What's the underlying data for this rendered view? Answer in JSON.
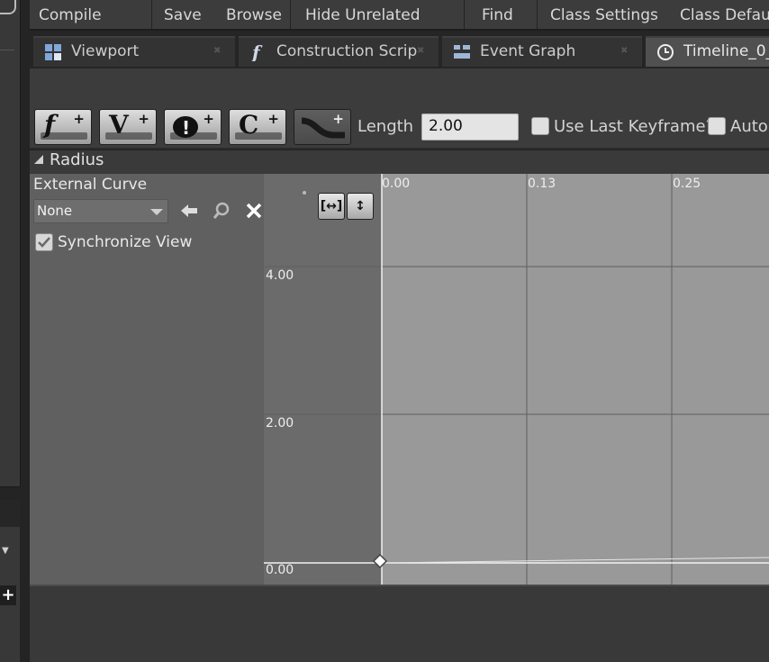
{
  "toolbar": {
    "compile": "Compile",
    "save": "Save",
    "browse": "Browse",
    "hide_unrelated": "Hide Unrelated",
    "find": "Find",
    "class_settings": "Class Settings",
    "class_defaults": "Class Defau"
  },
  "tabs": [
    {
      "label": "Viewport",
      "icon": "grid-icon"
    },
    {
      "label": "Construction Scrip",
      "icon": "function-icon"
    },
    {
      "label": "Event Graph",
      "icon": "event-graph-icon"
    },
    {
      "label": "Timeline_0_",
      "icon": "clock-icon"
    }
  ],
  "timeline_toolbar": {
    "add_float_glyph": "f",
    "add_vector_glyph": "V",
    "add_event_glyph": "!",
    "add_color_glyph": "C",
    "length_label": "Length",
    "length_value": "2.00",
    "use_last_keyframe": "Use Last Keyframe?",
    "use_last_keyframe_checked": false,
    "auto_label": "AutoP",
    "auto_checked": false
  },
  "track": {
    "name": "Radius",
    "external_curve_label": "External Curve",
    "external_curve_value": "None",
    "synchronize_view": "Synchronize View",
    "synchronize_checked": true
  },
  "graph": {
    "time_labels": [
      "0.00",
      "0.13",
      "0.25"
    ],
    "value_labels": [
      "4.00",
      "2.00",
      "0.00"
    ],
    "keyframes": [
      {
        "time": 0.0,
        "value": 0.0
      }
    ],
    "colors": {
      "background": "#999999",
      "outside": "#6b6b6b",
      "grid": "#5f5f5f",
      "curve": "#ffffff"
    }
  }
}
